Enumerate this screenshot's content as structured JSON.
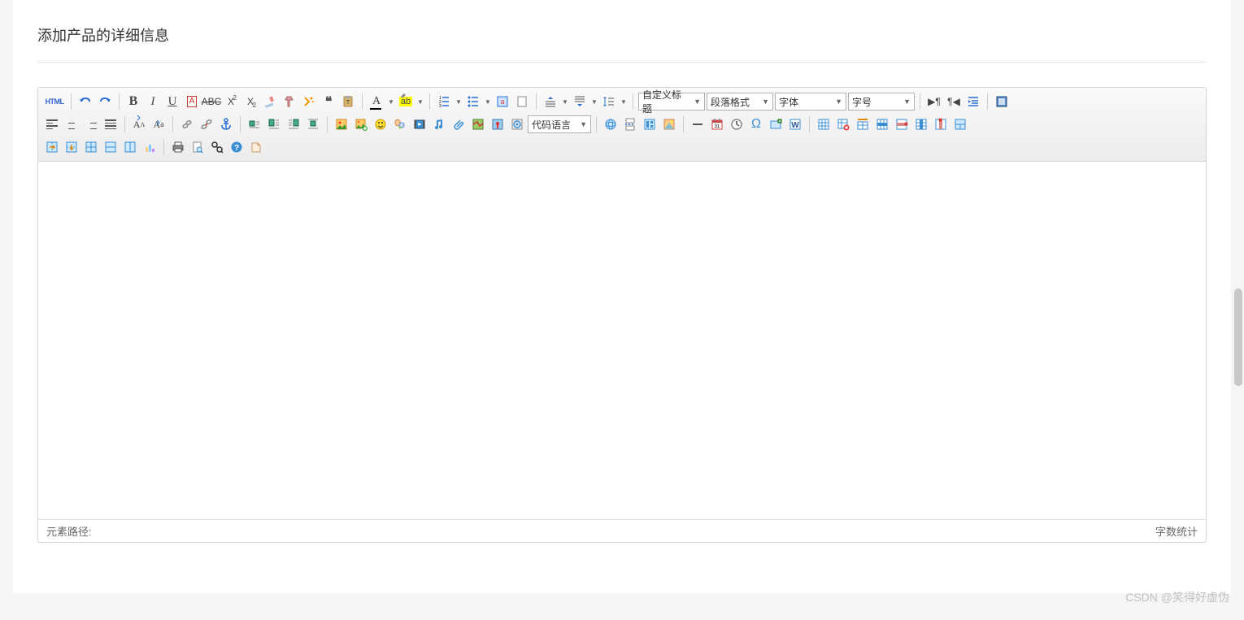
{
  "page": {
    "title": "添加产品的详细信息"
  },
  "toolbar": {
    "html_label": "HTML",
    "selects": {
      "custom_title": "自定义标题",
      "paragraph_format": "段落格式",
      "font_family": "字体",
      "font_size": "字号",
      "code_language": "代码语言"
    },
    "icons": {
      "undo": "undo-icon",
      "redo": "redo-icon",
      "bold": "B",
      "italic": "I",
      "underline": "U",
      "fontborder": "A",
      "strikethrough": "ABC",
      "superscript": "X",
      "subscript": "X"
    }
  },
  "status": {
    "element_path": "元素路径:",
    "word_count": "字数统计"
  },
  "watermark": "CSDN @笑得好虚伪"
}
